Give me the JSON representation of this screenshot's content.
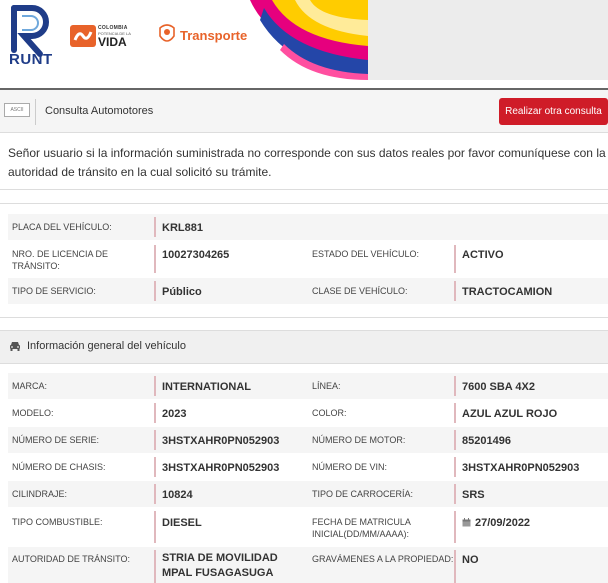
{
  "header": {
    "runt_logo_text": "RUNT",
    "colombia_line1": "COLOMBIA",
    "colombia_line2": "POTENCIA DE LA",
    "colombia_line3": "VIDA",
    "transporte_label": "Transporte"
  },
  "toolbar": {
    "ascii_icon_text": "ASCII",
    "title": "Consulta Automotores",
    "button_label": "Realizar otra consulta"
  },
  "notice": "Señor usuario si la información suministrada no corresponde con sus datos reales por favor comuníquese con la autoridad de tránsito en la cual solicitó su trámite.",
  "summary": {
    "placa_label": "PLACA DEL VEHÍCULO:",
    "placa_value": "KRL881",
    "licencia_label": "NRO. DE LICENCIA DE TRÁNSITO:",
    "licencia_value": "10027304265",
    "estado_label": "ESTADO DEL VEHÍCULO:",
    "estado_value": "ACTIVO",
    "servicio_label": "TIPO DE SERVICIO:",
    "servicio_value": "Público",
    "clase_label": "CLASE DE VEHÍCULO:",
    "clase_value": "TRACTOCAMION"
  },
  "section": {
    "icon": "car-icon",
    "title": "Información general del vehículo"
  },
  "details": {
    "marca_label": "MARCA:",
    "marca_value": "INTERNATIONAL",
    "linea_label": "LÍNEA:",
    "linea_value": "7600 SBA 4X2",
    "modelo_label": "MODELO:",
    "modelo_value": "2023",
    "color_label": "COLOR:",
    "color_value": "AZUL AZUL ROJO",
    "serie_label": "NÚMERO DE SERIE:",
    "serie_value": "3HSTXAHR0PN052903",
    "motor_label": "NÚMERO DE MOTOR:",
    "motor_value": "85201496",
    "chasis_label": "NÚMERO DE CHASIS:",
    "chasis_value": "3HSTXAHR0PN052903",
    "vin_label": "NÚMERO DE VIN:",
    "vin_value": "3HSTXAHR0PN052903",
    "cilindraje_label": "CILINDRAJE:",
    "cilindraje_value": "10824",
    "carroceria_label": "TIPO DE CARROCERÍA:",
    "carroceria_value": "SRS",
    "combustible_label": "TIPO COMBUSTIBLE:",
    "combustible_value": "DIESEL",
    "matricula_label": "FECHA DE MATRICULA INICIAL(DD/MM/AAAA):",
    "matricula_value": "27/09/2022",
    "autoridad_label": "AUTORIDAD DE TRÁNSITO:",
    "autoridad_value": "STRIA DE MOVILIDAD MPAL FUSAGASUGA",
    "gravamenes_label": "GRAVÁMENES A LA PROPIEDAD:",
    "gravamenes_value": "NO"
  },
  "colors": {
    "accent_red": "#cf1c28",
    "runt_blue": "#1f3c88",
    "transporte_orange": "#e8632a"
  }
}
